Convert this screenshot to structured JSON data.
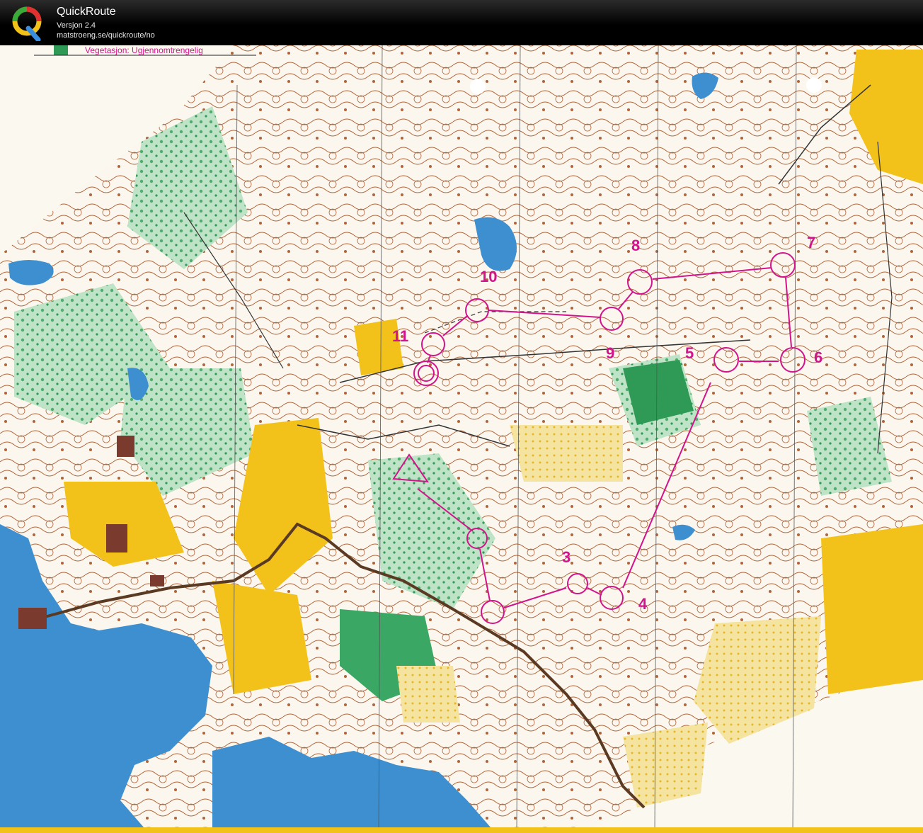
{
  "header": {
    "title": "QuickRoute",
    "version": "Versjon 2.4",
    "url": "matstroeng.se/quickroute/no"
  },
  "map": {
    "legend_text": "Vegetasjon: Ugjennomtrengelig",
    "course_color": "#d2148c",
    "control_numbers": [
      "3",
      "4",
      "5",
      "6",
      "7",
      "8",
      "9",
      "10",
      "11"
    ]
  },
  "colors": {
    "water": "#3d8fd0",
    "open_land": "#f2c21a",
    "forest_green": "#2e9a55",
    "contours": "#a0522d",
    "paper": "#fbf8f0",
    "road": "#5a3a22"
  },
  "icons": {
    "logo": "quickroute-q-logo"
  }
}
